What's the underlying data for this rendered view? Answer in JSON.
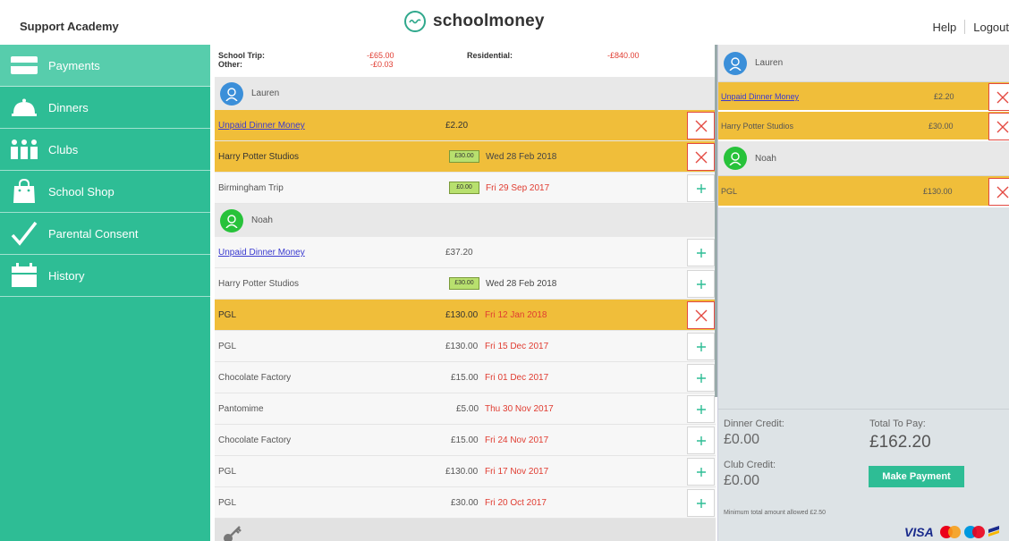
{
  "header": {
    "school_name": "Support Academy",
    "brand": "schoolmoney",
    "help": "Help",
    "logout": "Logout"
  },
  "sidebar": {
    "items": [
      {
        "label": "Payments",
        "icon": "card-icon"
      },
      {
        "label": "Dinners",
        "icon": "cloche-icon"
      },
      {
        "label": "Clubs",
        "icon": "people-icon"
      },
      {
        "label": "School Shop",
        "icon": "shopping-bag-icon"
      },
      {
        "label": "Parental Consent",
        "icon": "checkmark-icon"
      },
      {
        "label": "History",
        "icon": "calendar-icon"
      }
    ]
  },
  "summary": {
    "school_trip_label": "School Trip:",
    "school_trip_value": "-£65.00",
    "other_label": "Other:",
    "other_value": "-£0.03",
    "residential_label": "Residential:",
    "residential_value": "-£840.00"
  },
  "children": {
    "lauren": {
      "name": "Lauren",
      "rows": [
        {
          "name": "Unpaid Dinner Money",
          "amount": "£2.20",
          "date": ""
        },
        {
          "name": "Harry Potter Studios",
          "amount": "£30.00",
          "date": "Wed 28 Feb 2018"
        },
        {
          "name": "Birmingham Trip",
          "amount": "£0.00",
          "date": "Fri 29 Sep 2017"
        }
      ]
    },
    "noah": {
      "name": "Noah",
      "rows": [
        {
          "name": "Unpaid Dinner Money",
          "amount": "£37.20",
          "date": ""
        },
        {
          "name": "Harry Potter Studios",
          "amount": "£30.00",
          "date": "Wed 28 Feb 2018"
        },
        {
          "name": "PGL",
          "amount": "£130.00",
          "date": "Fri 12 Jan 2018"
        },
        {
          "name": "PGL",
          "amount": "£130.00",
          "date": "Fri 15 Dec 2017"
        },
        {
          "name": "Chocolate Factory",
          "amount": "£15.00",
          "date": "Fri 01 Dec 2017"
        },
        {
          "name": "Pantomime",
          "amount": "£5.00",
          "date": "Thu 30 Nov 2017"
        },
        {
          "name": "Chocolate Factory",
          "amount": "£15.00",
          "date": "Fri 24 Nov 2017"
        },
        {
          "name": "PGL",
          "amount": "£130.00",
          "date": "Fri 17 Nov 2017"
        },
        {
          "name": "PGL",
          "amount": "£30.00",
          "date": "Fri 20 Oct 2017"
        }
      ]
    }
  },
  "basket": {
    "lauren_name": "Lauren",
    "noah_name": "Noah",
    "items": [
      {
        "name": "Unpaid Dinner Money",
        "amount": "£2.20"
      },
      {
        "name": "Harry Potter Studios",
        "amount": "£30.00"
      },
      {
        "name": "PGL",
        "amount": "£130.00"
      }
    ],
    "dinner_credit_label": "Dinner Credit:",
    "dinner_credit_value": "£0.00",
    "club_credit_label": "Club Credit:",
    "club_credit_value": "£0.00",
    "total_label": "Total To Pay:",
    "total_value": "£162.20",
    "pay_button": "Make Payment",
    "min_note": "Minimum total amount allowed £2.50",
    "visa": "VISA"
  },
  "colors": {
    "accent": "#2ebd95",
    "highlight": "#f0be3a",
    "negative": "#e03c31"
  }
}
